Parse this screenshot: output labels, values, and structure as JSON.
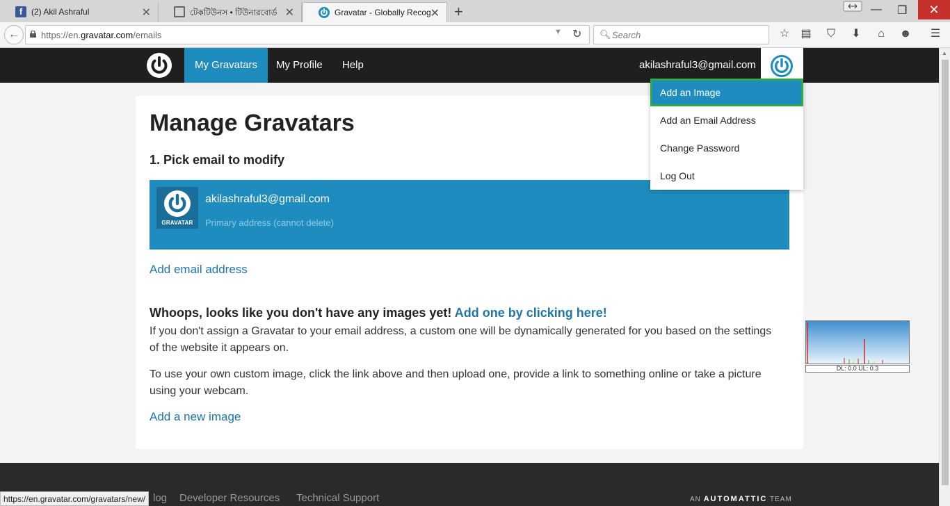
{
  "browser": {
    "tabs": [
      {
        "title": "(2) Akil Ashraful",
        "icon": "facebook-icon"
      },
      {
        "title": "টেকটিউনস • টিউনারবোর্ড",
        "icon": "techtunes-icon"
      },
      {
        "title": "Gravatar - Globally Recog...",
        "icon": "gravatar-icon"
      }
    ],
    "url_prefix": "https://en.",
    "url_domain": "gravatar.com",
    "url_path": "/emails",
    "search_placeholder": "Search"
  },
  "header": {
    "nav": [
      "My Gravatars",
      "My Profile",
      "Help"
    ],
    "user_email": "akilashraful3@gmail.com"
  },
  "dropdown": {
    "items": [
      "Add an Image",
      "Add an Email Address",
      "Change Password",
      "Log Out"
    ]
  },
  "main": {
    "title": "Manage Gravatars",
    "step": "1. Pick email to modify",
    "email": {
      "address": "akilashraful3@gmail.com",
      "note": "Primary address (cannot delete)",
      "avatar_label": "GRAVATAR"
    },
    "add_email_link": "Add email address",
    "whoops": "Whoops, looks like you don't have any images yet!",
    "whoops_cta": "Add one by clicking here!",
    "para1": "If you don't assign a Gravatar to your email address, a custom one will be dynamically generated for you based on the settings of the website it appears on.",
    "para2": "To use your own custom image, click the link above and then upload one, provide a link to something online or take a picture using your webcam.",
    "add_image_link": "Add a new image"
  },
  "speed_widget": {
    "label": "DL: 0.0 UL: 0.3"
  },
  "footer": {
    "links": [
      "log",
      "Developer Resources",
      "Technical Support"
    ],
    "brand_prefix": "AN",
    "brand_name": "AUTOMATTIC",
    "brand_suffix": "TEAM"
  },
  "status_url": "https://en.gravatar.com/gravatars/new/",
  "colors": {
    "accent": "#1e8cbe",
    "header_bg": "#1f1f1f",
    "highlight_border": "#2eaa4a"
  }
}
